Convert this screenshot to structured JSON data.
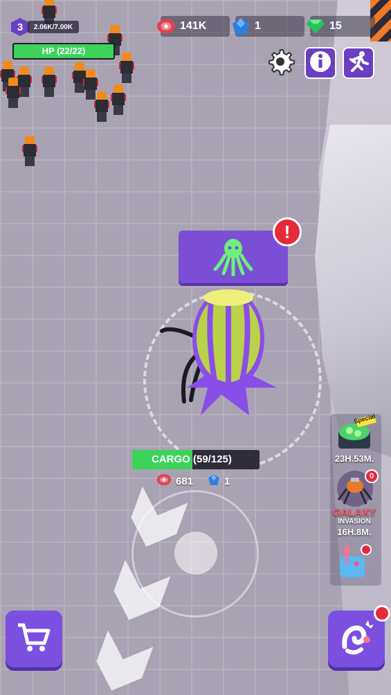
{
  "hud": {
    "level": "3",
    "xp": "2.06K/7.00K",
    "hp_label": "HP (22/22)",
    "hp_fraction": 1.0,
    "meat": "141K",
    "crystal": "1",
    "gems": "15"
  },
  "cargo": {
    "label": "CARGO (59/125)",
    "fraction": 0.472,
    "meat": "681",
    "crystal": "1"
  },
  "alert": "!",
  "side": {
    "special_badge": "Special",
    "special_timer": "23H.53M.",
    "galaxy_badge_count": "0",
    "galaxy_title": "GALAXY",
    "galaxy_subtitle": "INVASION",
    "galaxy_timer": "16H.8M."
  },
  "colors": {
    "accent_purple": "#7b4fe0",
    "hp_green": "#3dd35b",
    "alert_red": "#e52a3a"
  }
}
